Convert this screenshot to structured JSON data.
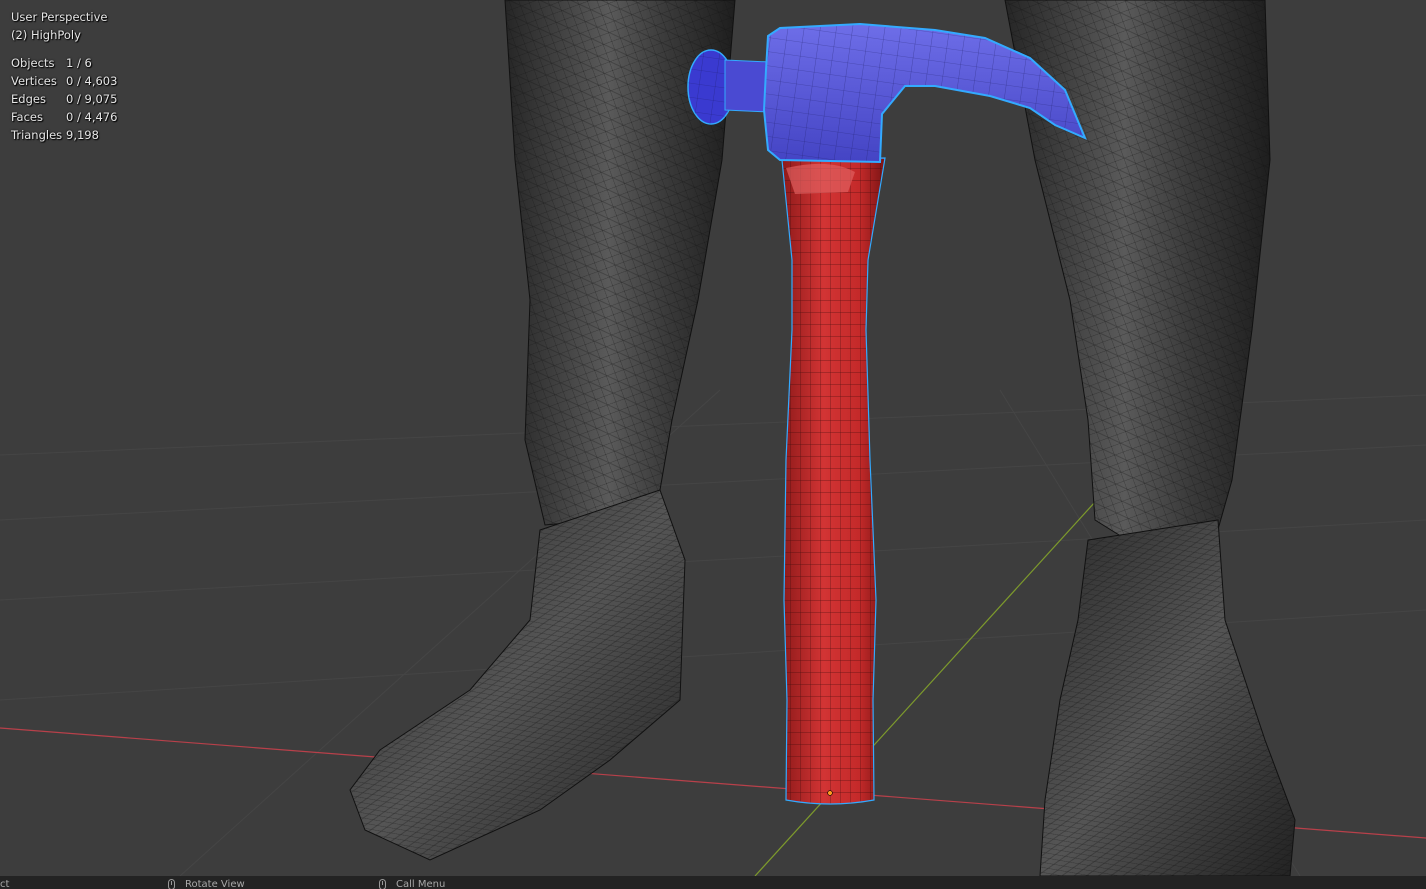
{
  "viewport": {
    "view_name": "User Perspective",
    "object_name": "(2) HighPoly",
    "stats": [
      {
        "label": "Objects",
        "value": "1 / 6"
      },
      {
        "label": "Vertices",
        "value": "0 / 4,603"
      },
      {
        "label": "Edges",
        "value": "0 / 9,075"
      },
      {
        "label": "Faces",
        "value": "0 / 4,476"
      },
      {
        "label": "Triangles",
        "value": "9,198"
      }
    ],
    "colors": {
      "background": "#3d3d3d",
      "grid": "#444444",
      "x_axis": "#b8404a",
      "y_axis": "#7d9a2c",
      "character_mesh": "#2c2c2c",
      "hammer_head": "#5a5ad6",
      "hammer_handle": "#cc2c2c",
      "selection_outline": "#33aaff"
    }
  },
  "statusbar": {
    "item1": "ct",
    "item2": "Rotate View",
    "item3": "Call Menu"
  }
}
